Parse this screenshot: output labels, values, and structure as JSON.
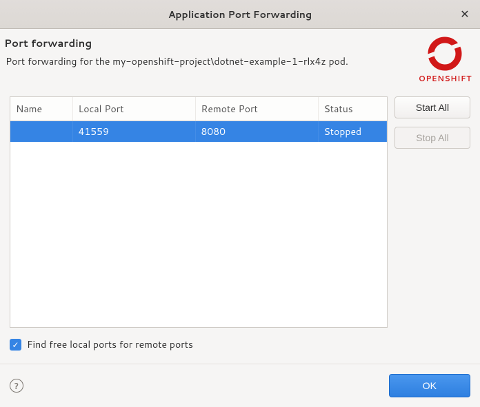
{
  "window": {
    "title": "Application Port Forwarding"
  },
  "header": {
    "title": "Port forwarding",
    "description": "Port forwarding for the my-openshift-project\\dotnet-example-1-rlx4z pod.",
    "logo_text": "OPENSHIFT"
  },
  "table": {
    "columns": {
      "name": "Name",
      "local_port": "Local Port",
      "remote_port": "Remote Port",
      "status": "Status"
    },
    "rows": [
      {
        "name": "",
        "local_port": "41559",
        "remote_port": "8080",
        "status": "Stopped"
      }
    ]
  },
  "buttons": {
    "start_all": "Start All",
    "stop_all": "Stop All",
    "ok": "OK"
  },
  "checkbox": {
    "label": "Find free local ports for remote ports",
    "checked": true
  }
}
